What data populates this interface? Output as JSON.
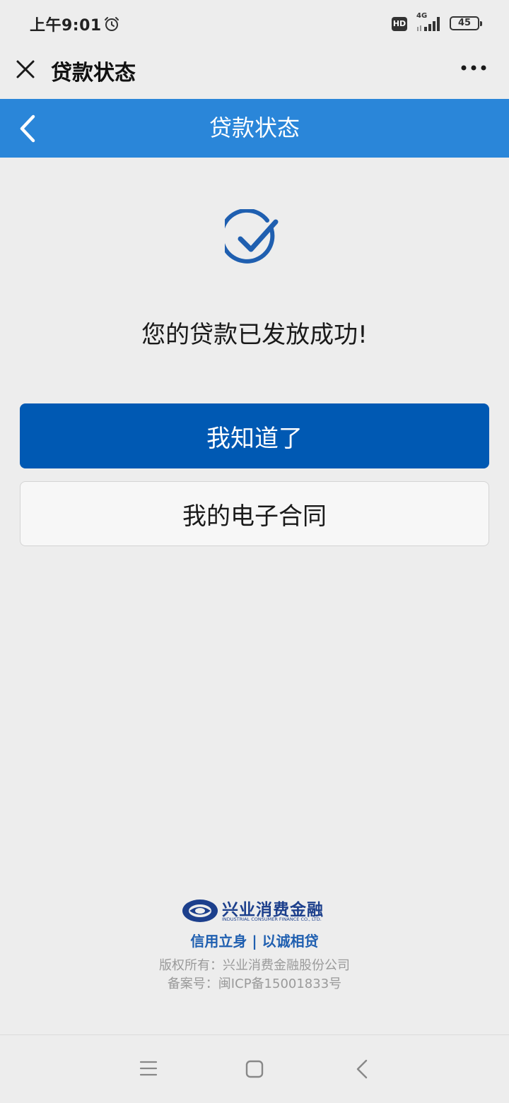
{
  "status_bar": {
    "time": "上午9:01",
    "hd_badge": "HD",
    "network": "4G",
    "battery": "45"
  },
  "wx_header": {
    "title": "贷款状态"
  },
  "app_header": {
    "title": "贷款状态"
  },
  "result": {
    "message": "您的贷款已发放成功!"
  },
  "actions": {
    "primary_label": "我知道了",
    "secondary_label": "我的电子合同"
  },
  "footer": {
    "logo_cn": "兴业消费金融",
    "logo_en": "INDUSTRIAL CONSUMER FINANCE CO., LTD.",
    "slogan": "信用立身 | 以诚相贷",
    "copyright": "版权所有：兴业消费金融股份公司",
    "icp": "备案号：闽ICP备15001833号"
  },
  "icons": {
    "alarm": "alarm-icon",
    "signal": "signal-icon",
    "close": "close-icon",
    "more": "more-icon",
    "back": "back-icon",
    "success": "check-circle-icon",
    "nav_menu": "menu-icon",
    "nav_home": "home-icon",
    "nav_back": "back-icon"
  },
  "colors": {
    "app_header_bg": "#2a86d9",
    "primary_button": "#0059b3",
    "success_icon": "#1f5fb0",
    "brand": "#1c3f8c"
  }
}
